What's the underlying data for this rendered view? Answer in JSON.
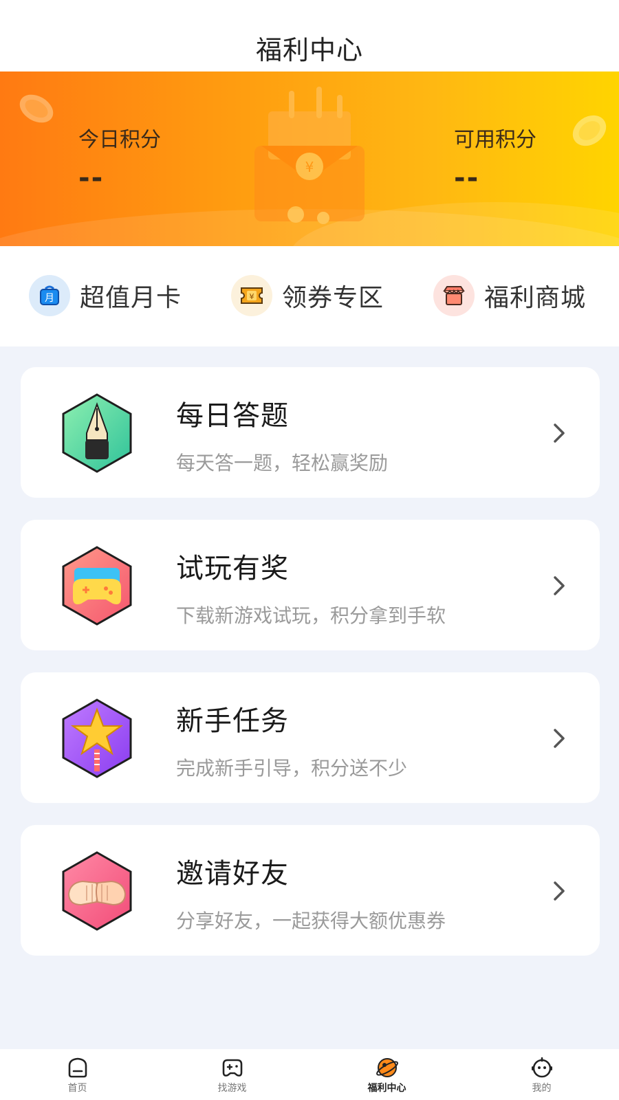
{
  "header": {
    "title": "福利中心"
  },
  "banner": {
    "today_points": {
      "label": "今日积分",
      "value": "--"
    },
    "available_points": {
      "label": "可用积分",
      "value": "--"
    }
  },
  "quick_links": [
    {
      "label": "超值月卡",
      "icon": "monthly-card-icon",
      "bg": "#dcebfa"
    },
    {
      "label": "领券专区",
      "icon": "coupon-icon",
      "bg": "#fcf1dc"
    },
    {
      "label": "福利商城",
      "icon": "store-icon",
      "bg": "#fde3df"
    }
  ],
  "tasks": [
    {
      "title": "每日答题",
      "desc": "每天答一题，轻松赢奖励",
      "icon": "pen-icon"
    },
    {
      "title": "试玩有奖",
      "desc": "下载新游戏试玩，积分拿到手软",
      "icon": "gamepad-icon"
    },
    {
      "title": "新手任务",
      "desc": "完成新手引导，积分送不少",
      "icon": "star-wand-icon"
    },
    {
      "title": "邀请好友",
      "desc": "分享好友，一起获得大额优惠券",
      "icon": "fist-bump-icon"
    }
  ],
  "tabbar": {
    "items": [
      {
        "label": "首页",
        "icon": "home-icon",
        "active": false
      },
      {
        "label": "找游戏",
        "icon": "gamepad-icon",
        "active": false
      },
      {
        "label": "福利中心",
        "icon": "planet-icon",
        "active": true
      },
      {
        "label": "我的",
        "icon": "profile-icon",
        "active": false
      }
    ]
  },
  "colors": {
    "banner_start": "#ff7a12",
    "banner_end": "#ffd400",
    "page_bg": "#f0f3fa",
    "accent_orange": "#ff8a1a"
  }
}
